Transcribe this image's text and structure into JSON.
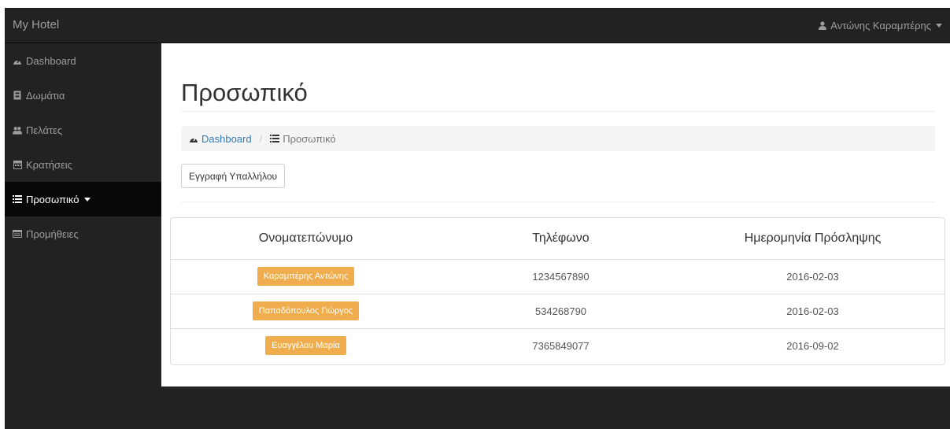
{
  "navbar": {
    "brand": "My Hotel",
    "user_name": "Αντώνης Καραμπέρης",
    "user_icon": "user-icon",
    "caret_icon": "caret-down-icon"
  },
  "sidebar": {
    "items": [
      {
        "label": "Dashboard",
        "icon": "dashboard-icon",
        "active": false
      },
      {
        "label": "Δωμάτια",
        "icon": "room-icon",
        "active": false
      },
      {
        "label": "Πελάτες",
        "icon": "users-icon",
        "active": false
      },
      {
        "label": "Κρατήσεις",
        "icon": "calendar-icon",
        "active": false
      },
      {
        "label": "Προσωπικό",
        "icon": "list-icon",
        "active": true
      },
      {
        "label": "Προμήθειες",
        "icon": "supplies-icon",
        "active": false
      }
    ]
  },
  "main": {
    "title": "Προσωπικό",
    "breadcrumb": {
      "home": "Dashboard",
      "current": "Προσωπικό"
    },
    "register_button": "Εγγραφή Υπαλλήλου",
    "table": {
      "headers": [
        "Ονοματεπώνυμο",
        "Τηλέφωνο",
        "Ημερομηνία Πρόσληψης"
      ],
      "rows": [
        {
          "name": "Καραμπέρης Αντώνης",
          "phone": "1234567890",
          "date": "2016-02-03"
        },
        {
          "name": "Παπαδόπουλος Γιώργος",
          "phone": "534268790",
          "date": "2016-02-03"
        },
        {
          "name": "Ευαγγέλου Μαρία",
          "phone": "7365849077",
          "date": "2016-09-02"
        }
      ]
    }
  },
  "colors": {
    "navbar_bg": "#222222",
    "active_bg": "#080808",
    "badge": "#f0ad4e",
    "link": "#337ab7"
  }
}
